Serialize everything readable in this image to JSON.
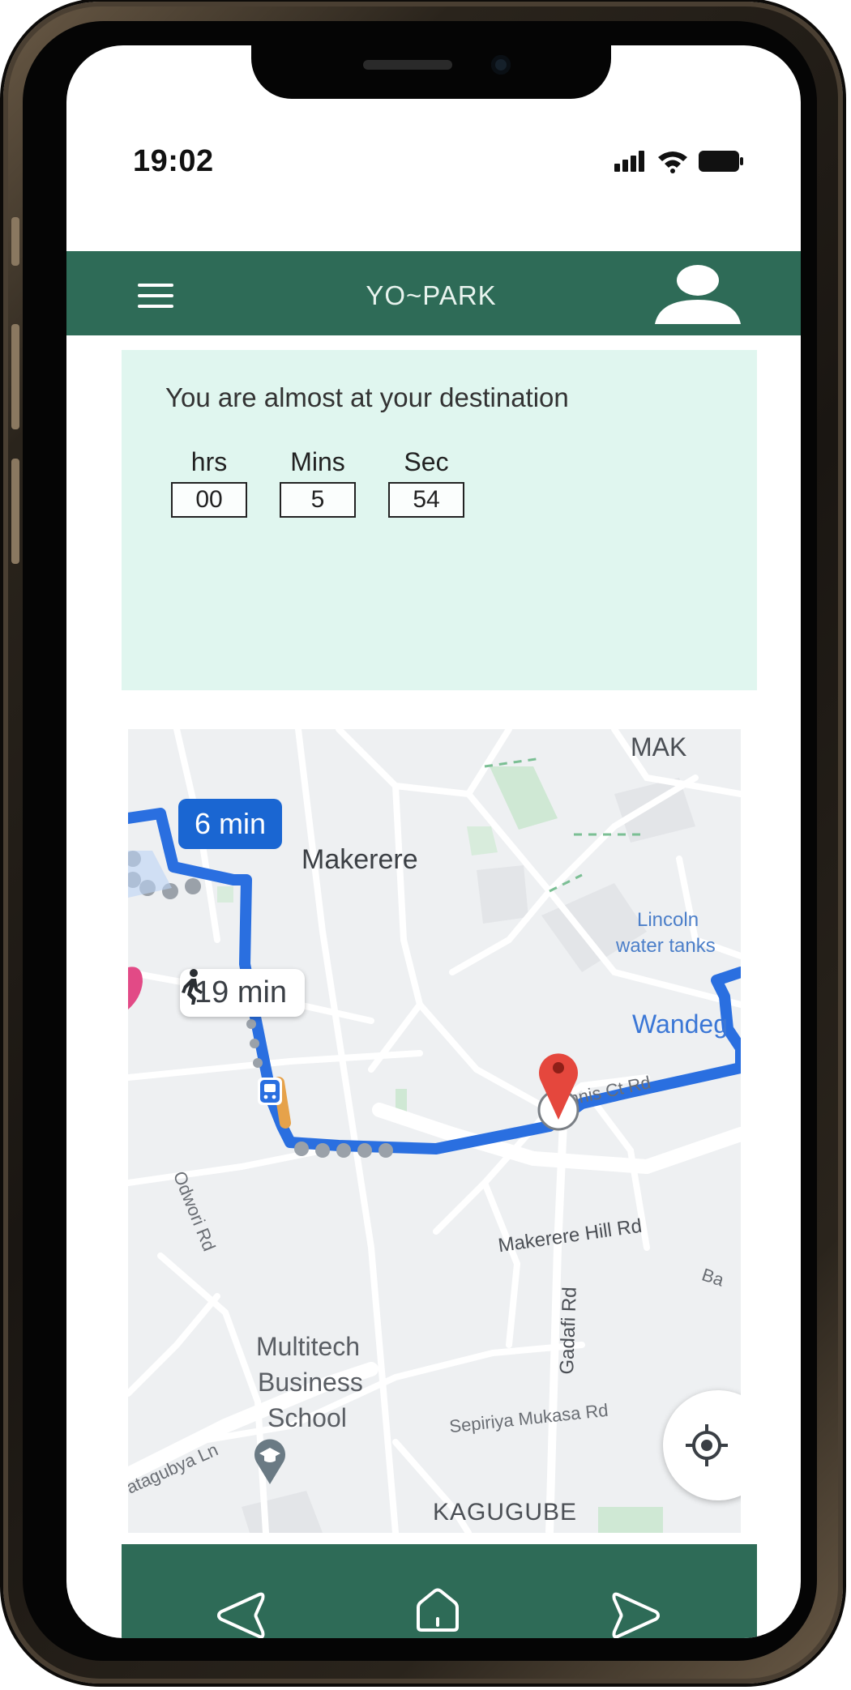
{
  "status_bar": {
    "time": "19:02",
    "icons": [
      "signal-icon",
      "wifi-icon",
      "battery-icon"
    ]
  },
  "header": {
    "title": "YO~PARK",
    "menu_icon": "menu-icon",
    "profile_icon": "user-profile-icon"
  },
  "info": {
    "message": "You are almost at your destination",
    "timer": {
      "hours_label": "hrs",
      "minutes_label": "Mins",
      "seconds_label": "Sec",
      "hours": "00",
      "minutes": "5",
      "seconds": "54"
    }
  },
  "map": {
    "drive_eta": "6 min",
    "walk_eta": "19 min",
    "labels": {
      "makerere": "Makerere",
      "mak_corner": "MAK",
      "lincoln": "Lincoln",
      "water_tanks": "water tanks",
      "wandegeya": "Wandeg",
      "tennis": "Tennis Ct Rd",
      "odwori": "Odwori Rd",
      "makerere_hill": "Makerere Hill Rd",
      "gadafi": "Gadafi Rd",
      "ba": "Ba",
      "multitech_1": "Multitech",
      "multitech_2": "Business",
      "multitech_3": "School",
      "sepiriya": "Sepiriya Mukasa Rd",
      "kagugube": "KAGUGUBE",
      "katagubya": "atagubya Ln"
    },
    "icons": [
      "walk-icon",
      "bus-stop-icon",
      "destination-pin-icon",
      "school-pin-icon",
      "my-location-icon"
    ]
  },
  "nav": {
    "icons": [
      "back-triangle-icon",
      "home-icon",
      "forward-triangle-icon"
    ]
  },
  "colors": {
    "brand_green": "#2e6b57",
    "panel_mint": "#e0f6ef",
    "route_blue": "#2a6fe0",
    "pin_red": "#e5473d"
  }
}
